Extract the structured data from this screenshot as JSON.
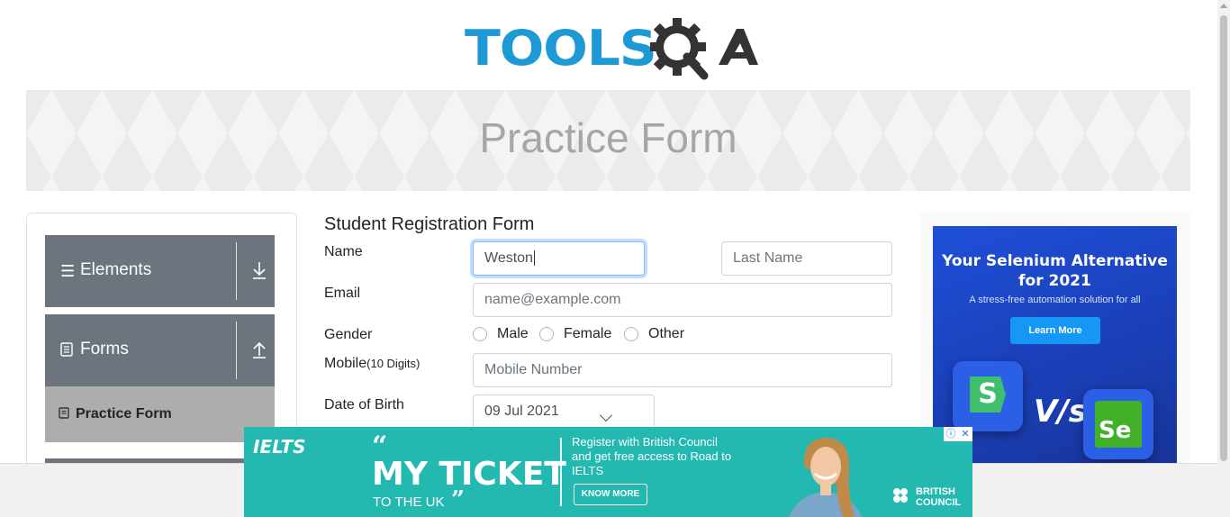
{
  "brand": {
    "logo_text": "TOOLS",
    "logo_suffix": "QA",
    "primary_color": "#1d9ad6"
  },
  "banner": {
    "title": "Practice Form"
  },
  "sidebar": {
    "groups": [
      {
        "label": "Elements",
        "icon": "hamburger-icon",
        "toggle_icon": "download-arrow-icon"
      },
      {
        "label": "Forms",
        "icon": "document-icon",
        "toggle_icon": "upload-arrow-icon"
      }
    ],
    "active_item": {
      "label": "Practice Form",
      "icon": "document-icon"
    },
    "active_color": "#adadad",
    "group_color": "#6c757d"
  },
  "form": {
    "title": "Student Registration Form",
    "name_label": "Name",
    "first_name_value": "Weston",
    "last_name_placeholder": "Last Name",
    "email_label": "Email",
    "email_placeholder": "name@example.com",
    "gender_label": "Gender",
    "gender_options": [
      "Male",
      "Female",
      "Other"
    ],
    "mobile_label": "Mobile",
    "mobile_hint": "(10 Digits)",
    "mobile_placeholder": "Mobile Number",
    "dob_label": "Date of Birth",
    "dob_value": "09 Jul 2021"
  },
  "ad_right": {
    "headline": "Your Selenium Alternative for 2021",
    "subline": "A stress-free automation solution for all",
    "button": "Learn More",
    "vs_text": "V/s",
    "logo1_text": "S",
    "logo2_text": "Se"
  },
  "ad_bottom": {
    "brand": "IELTS",
    "headline": "MY TICKET",
    "subline": "TO THE UK",
    "register_text": "Register with British Council and get free access to Road to IELTS",
    "button": "KNOW MORE",
    "sponsor_line1": "BRITISH",
    "sponsor_line2": "COUNCIL",
    "info_icon": "info-icon",
    "close_icon": "close-icon"
  }
}
